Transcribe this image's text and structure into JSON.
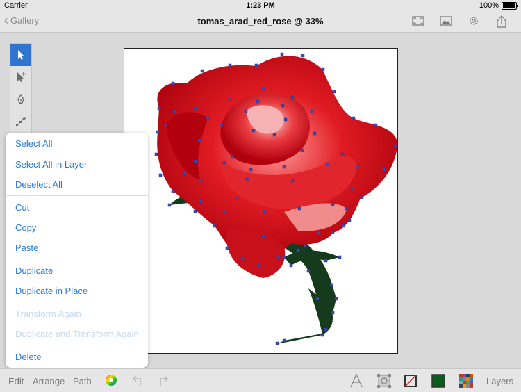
{
  "status_bar": {
    "carrier": "Carrier",
    "time": "1:23 PM",
    "battery": "100%"
  },
  "nav": {
    "back_label": "Gallery",
    "title": "tomas_arad_red_rose @ 33%",
    "icons": [
      "fullscreen-icon",
      "image-icon",
      "gear-icon",
      "share-icon"
    ]
  },
  "tools": [
    "select-arrow",
    "direct-select-arrow",
    "pen",
    "add-anchor-point"
  ],
  "edit_menu": {
    "items": [
      {
        "label": "Select All",
        "enabled": true
      },
      {
        "label": "Select All in Layer",
        "enabled": true
      },
      {
        "label": "Deselect All",
        "enabled": true
      },
      {
        "label": "Cut",
        "enabled": true
      },
      {
        "label": "Copy",
        "enabled": true
      },
      {
        "label": "Paste",
        "enabled": true
      },
      {
        "label": "Duplicate",
        "enabled": true
      },
      {
        "label": "Duplicate in Place",
        "enabled": true
      },
      {
        "label": "Transform Again",
        "enabled": false
      },
      {
        "label": "Duplicate and Transform Again",
        "enabled": false
      },
      {
        "label": "Delete",
        "enabled": true
      }
    ]
  },
  "bottom_bar": {
    "edit": "Edit",
    "arrange": "Arrange",
    "path": "Path",
    "layers": "Layers",
    "fill_color": "#0b5e1a"
  },
  "colors": {
    "accent": "#2f74d0",
    "menu_text": "#2a7bd6",
    "rose_red": "#c8101a",
    "stem_green": "#163a1c",
    "anchor_blue": "#3b4bb8"
  }
}
